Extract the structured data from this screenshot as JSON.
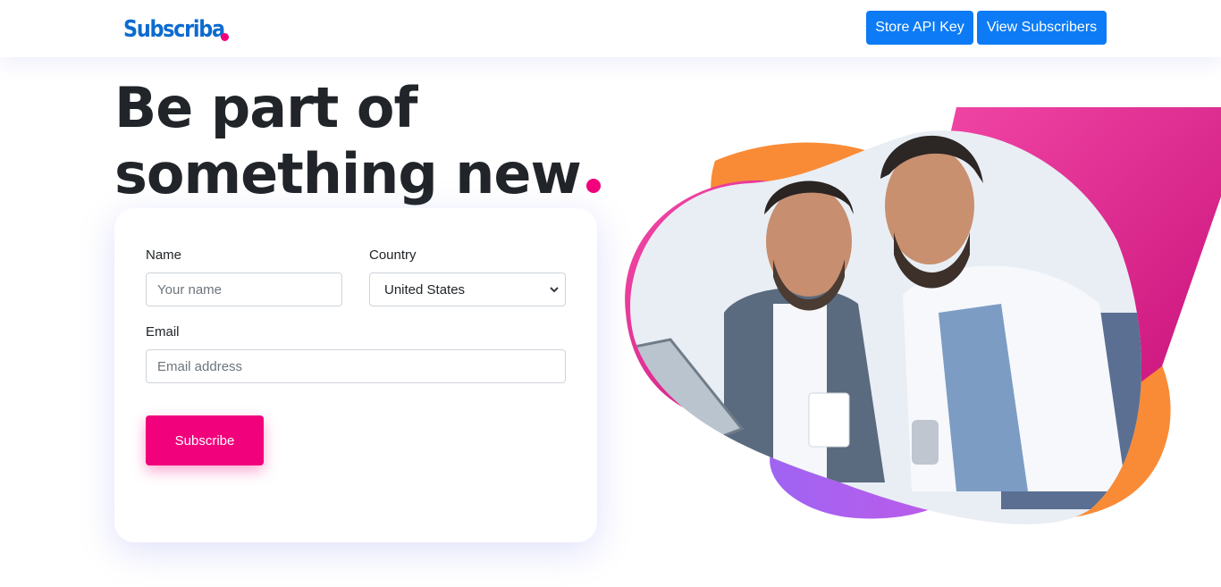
{
  "nav": {
    "brand": "Subscriba",
    "store_api_key": "Store API Key",
    "view_subscribers": "View Subscribers"
  },
  "hero": {
    "line1_a": "Be part ",
    "line1_b": "of",
    "line2": "something new"
  },
  "form": {
    "name_label": "Name",
    "name_placeholder": "Your name",
    "country_label": "Country",
    "country_value": "United States",
    "email_label": "Email",
    "email_placeholder": "Email address",
    "submit_label": "Subscribe"
  },
  "colors": {
    "brand": "#0d6bd0",
    "accent_pink": "#f1027c",
    "primary_blue": "#0d7bf5",
    "art_orange": "#f98b37",
    "art_purple": "#a95cf0",
    "art_magenta": "#e2268f"
  },
  "icons": {
    "brand_dot": "dot",
    "select_caret": "chevron-down-icon"
  }
}
